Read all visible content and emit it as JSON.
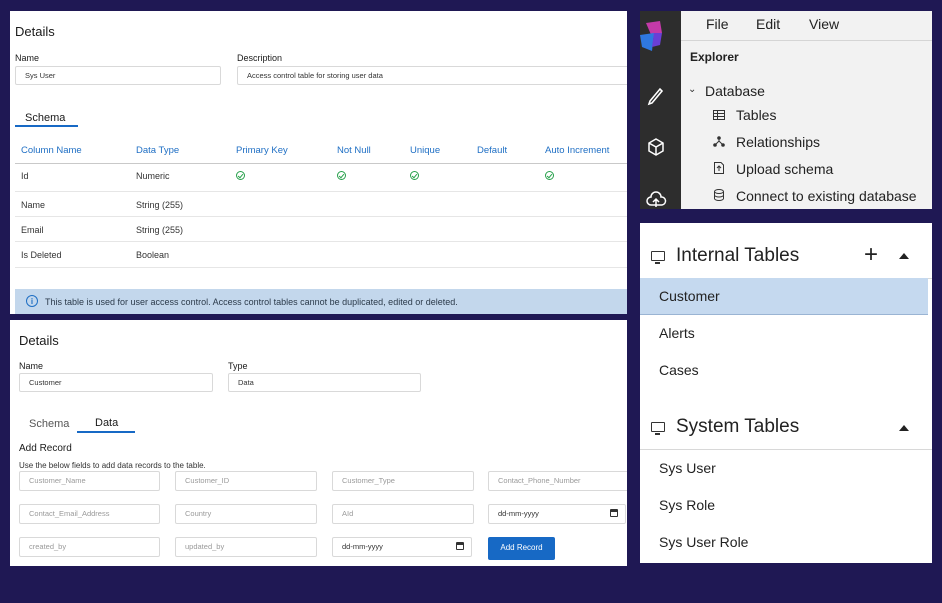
{
  "sys_user_panel": {
    "title": "Details",
    "name_label": "Name",
    "name_value": "Sys User",
    "description_label": "Description",
    "description_value": "Access control table for storing user data",
    "tab_schema": "Schema",
    "columns": [
      "Column Name",
      "Data Type",
      "Primary Key",
      "Not Null",
      "Unique",
      "Default",
      "Auto Increment"
    ],
    "rows": [
      {
        "name": "Id",
        "type": "Numeric",
        "primary_key": true,
        "not_null": true,
        "unique": true,
        "auto_increment": true
      },
      {
        "name": "Name",
        "type": "String (255)",
        "primary_key": false,
        "not_null": false,
        "unique": false,
        "auto_increment": false
      },
      {
        "name": "Email",
        "type": "String (255)",
        "primary_key": false,
        "not_null": false,
        "unique": false,
        "auto_increment": false
      },
      {
        "name": "Is Deleted",
        "type": "Boolean",
        "primary_key": false,
        "not_null": false,
        "unique": false,
        "auto_increment": false
      }
    ],
    "info_icon": "info-circle-icon",
    "info_text": "This table is used for user access control. Access control tables cannot be duplicated, edited or deleted."
  },
  "customer_panel": {
    "title": "Details",
    "name_label": "Name",
    "name_value": "Customer",
    "type_label": "Type",
    "type_value": "Data",
    "tab_schema": "Schema",
    "tab_data": "Data",
    "add_record_title": "Add Record",
    "add_record_hint": "Use the below fields to add data records to the table.",
    "fields": {
      "customer_name": "Customer_Name",
      "customer_id": "Customer_ID",
      "customer_type": "Customer_Type",
      "contact_phone": "Contact_Phone_Number",
      "contact_email": "Contact_Email_Address",
      "country": "Country",
      "aid": "AId",
      "date1": "dd-mm-yyyy",
      "created_by": "created_by",
      "updated_by": "updated_by",
      "date2": "dd-mm-yyyy"
    },
    "add_button": "Add Record"
  },
  "explorer_panel": {
    "menu": {
      "file": "File",
      "edit": "Edit",
      "view": "View"
    },
    "title": "Explorer",
    "database_label": "Database",
    "items": {
      "tables": "Tables",
      "relationships": "Relationships",
      "upload_schema": "Upload schema",
      "connect": "Connect to existing database"
    }
  },
  "tables_panel": {
    "internal_title": "Internal Tables",
    "internal_items": [
      "Customer",
      "Alerts",
      "Cases"
    ],
    "system_title": "System Tables",
    "system_items": [
      "Sys User",
      "Sys Role",
      "Sys User Role"
    ]
  },
  "colors": {
    "background": "#1f1854",
    "accent": "#1769c5",
    "check": "#27a14b",
    "selected_row": "#c5d9ef",
    "info_bar": "#c3d7ec"
  }
}
